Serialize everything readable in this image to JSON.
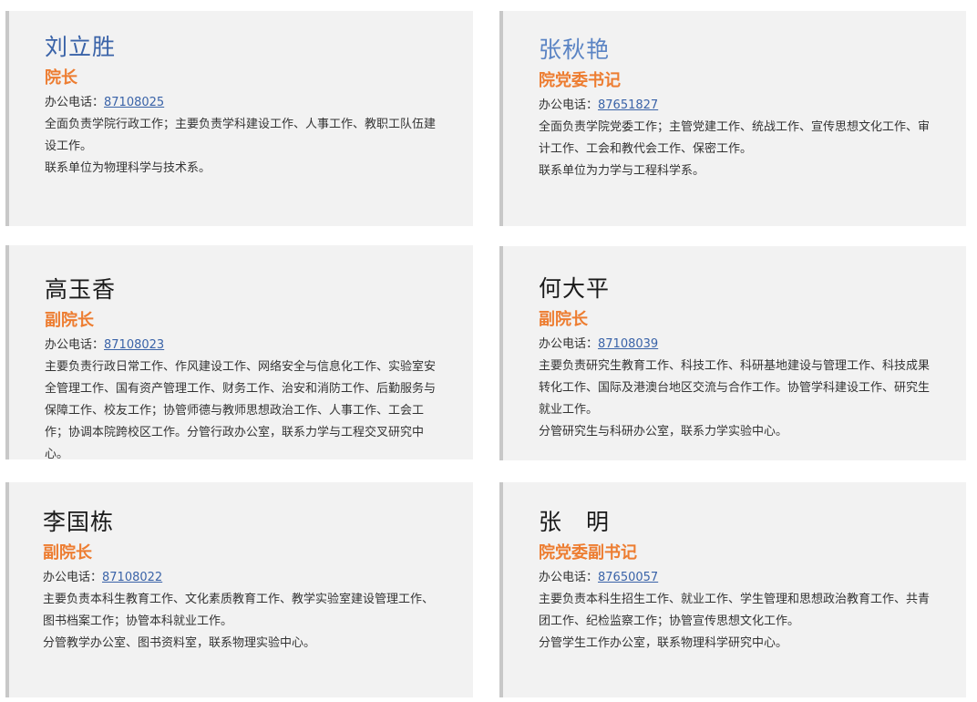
{
  "phone_label": "办公电话：",
  "cards": [
    {
      "name": "刘立胜",
      "role": "院长",
      "phone": "87108025",
      "duties": "全面负责学院行政工作；主要负责学科建设工作、人事工作、教职工队伍建设工作。",
      "contact": "联系单位为物理科学与技术系。"
    },
    {
      "name": "张秋艳",
      "role": "院党委书记",
      "phone": "87651827",
      "duties": "全面负责学院党委工作；主管党建工作、统战工作、宣传思想文化工作、审计工作、工会和教代会工作、保密工作。",
      "contact": "联系单位为力学与工程科学系。"
    },
    {
      "name": "高玉香",
      "role": "副院长",
      "phone": "87108023",
      "duties": "主要负责行政日常工作、作风建设工作、网络安全与信息化工作、实验室安全管理工作、国有资产管理工作、财务工作、治安和消防工作、后勤服务与保障工作、校友工作；协管师德与教师思想政治工作、人事工作、工会工作；协调本院跨校区工作。分管行政办公室，联系力学与工程交叉研究中心。",
      "contact": ""
    },
    {
      "name": "何大平",
      "role": "副院长",
      "phone": "87108039",
      "duties": "主要负责研究生教育工作、科技工作、科研基地建设与管理工作、科技成果转化工作、国际及港澳台地区交流与合作工作。协管学科建设工作、研究生就业工作。",
      "contact": "分管研究生与科研办公室，联系力学实验中心。"
    },
    {
      "name": "李国栋",
      "role": "副院长",
      "phone": "87108022",
      "duties": "主要负责本科生教育工作、文化素质教育工作、教学实验室建设管理工作、图书档案工作；协管本科就业工作。",
      "contact": "分管教学办公室、图书资料室，联系物理实验中心。"
    },
    {
      "name": "张　明",
      "role": "院党委副书记",
      "phone": "87650057",
      "duties": "主要负责本科生招生工作、就业工作、学生管理和思想政治教育工作、共青团工作、纪检监察工作；协管宣传思想文化工作。",
      "contact": "分管学生工作办公室，联系物理科学研究中心。"
    }
  ],
  "colors": {
    "card_bg": "#f2f2f2",
    "card_border": "#c8c8c8",
    "role": "#ed7d31",
    "link": "#3a63a8",
    "name_blue": "#3a63a8",
    "name_lightblue": "#5b84c4"
  }
}
